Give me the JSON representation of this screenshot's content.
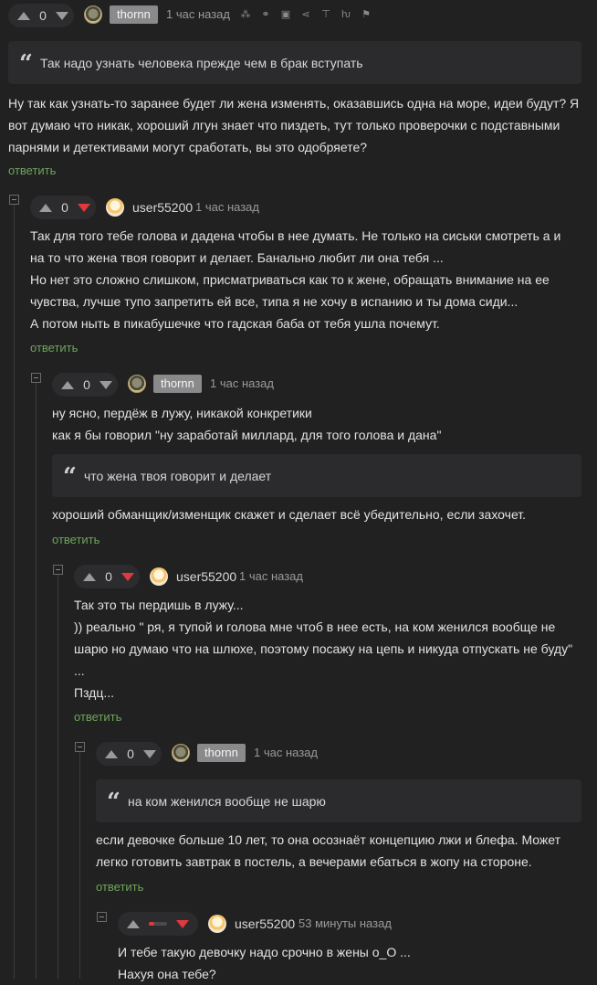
{
  "root": {
    "score": "0",
    "nick": "thornn",
    "time": "1 час назад",
    "toolbar_icons": [
      "coins-icon",
      "link-icon",
      "save-icon",
      "share-icon",
      "pin-icon",
      "tree-icon",
      "flag-icon"
    ],
    "quote": "Так надо узнать человека прежде чем в брак вступать",
    "text": "Ну так как узнать-то заранее будет ли жена изменять, оказавшись одна на море, идеи будут? Я\nвот думаю что никак, хороший лгун знает что пиздеть, тут только проверочки с подставными\nпарнями и детективами могут сработать, вы это одобряете?",
    "reply": "ответить"
  },
  "c1": {
    "score": "0",
    "nick": "user55200",
    "time": "1 час назад",
    "text": "Так для того тебе голова и дадена чтобы в нее думать. Не только на сиськи смотреть а и\nна то что жена твоя говорит и делает. Банально любит ли она тебя ...\nНо нет это сложно слишком, присматриваться как то к жене, обращать внимание на ее\nчувства, лучше тупо запретить ей все, типа я не хочу в испанию и ты дома сиди...\nА потом ныть в пикабушечке что гадская баба от тебя ушла почемут.",
    "reply": "ответить"
  },
  "c2": {
    "score": "0",
    "nick": "thornn",
    "time": "1 час назад",
    "text1": "ну ясно, пердёж в лужу, никакой конкретики\nкак я бы говорил \"ну заработай миллард, для того голова и дана\"",
    "quote": "что жена твоя говорит и делает",
    "text2": "хороший обманщик/изменщик скажет и сделает всё убедительно, если захочет.",
    "reply": "ответить"
  },
  "c3": {
    "score": "0",
    "nick": "user55200",
    "time": "1 час назад",
    "text": "Так это ты пердишь в лужу...\n)) реально \" ря, я тупой и голова мне чтоб в нее есть, на ком женился вообще не\nшарю но думаю что на шлюхе, поэтому посажу на цепь и никуда отпускать не буду\"\n...\nПздц...",
    "reply": "ответить"
  },
  "c4": {
    "score": "0",
    "nick": "thornn",
    "time": "1 час назад",
    "quote": "на ком женился вообще не шарю",
    "text": "если девочке больше 10 лет, то она осознаёт концепцию лжи и блефа. Может\nлегко готовить завтрак в постель, а вечерами ебаться в жопу на стороне.",
    "reply": "ответить"
  },
  "c5": {
    "score_fraction_negative": 0.3,
    "nick": "user55200",
    "time": "53 минуты назад",
    "text": "И тебе такую девочку надо срочно в жены о_О ...\nНахуя она тебе?"
  },
  "colors": {
    "background": "#212122",
    "reply_link": "#6ea55a",
    "downvote": "#e0393e",
    "quote_bg": "#2b2b2d"
  }
}
